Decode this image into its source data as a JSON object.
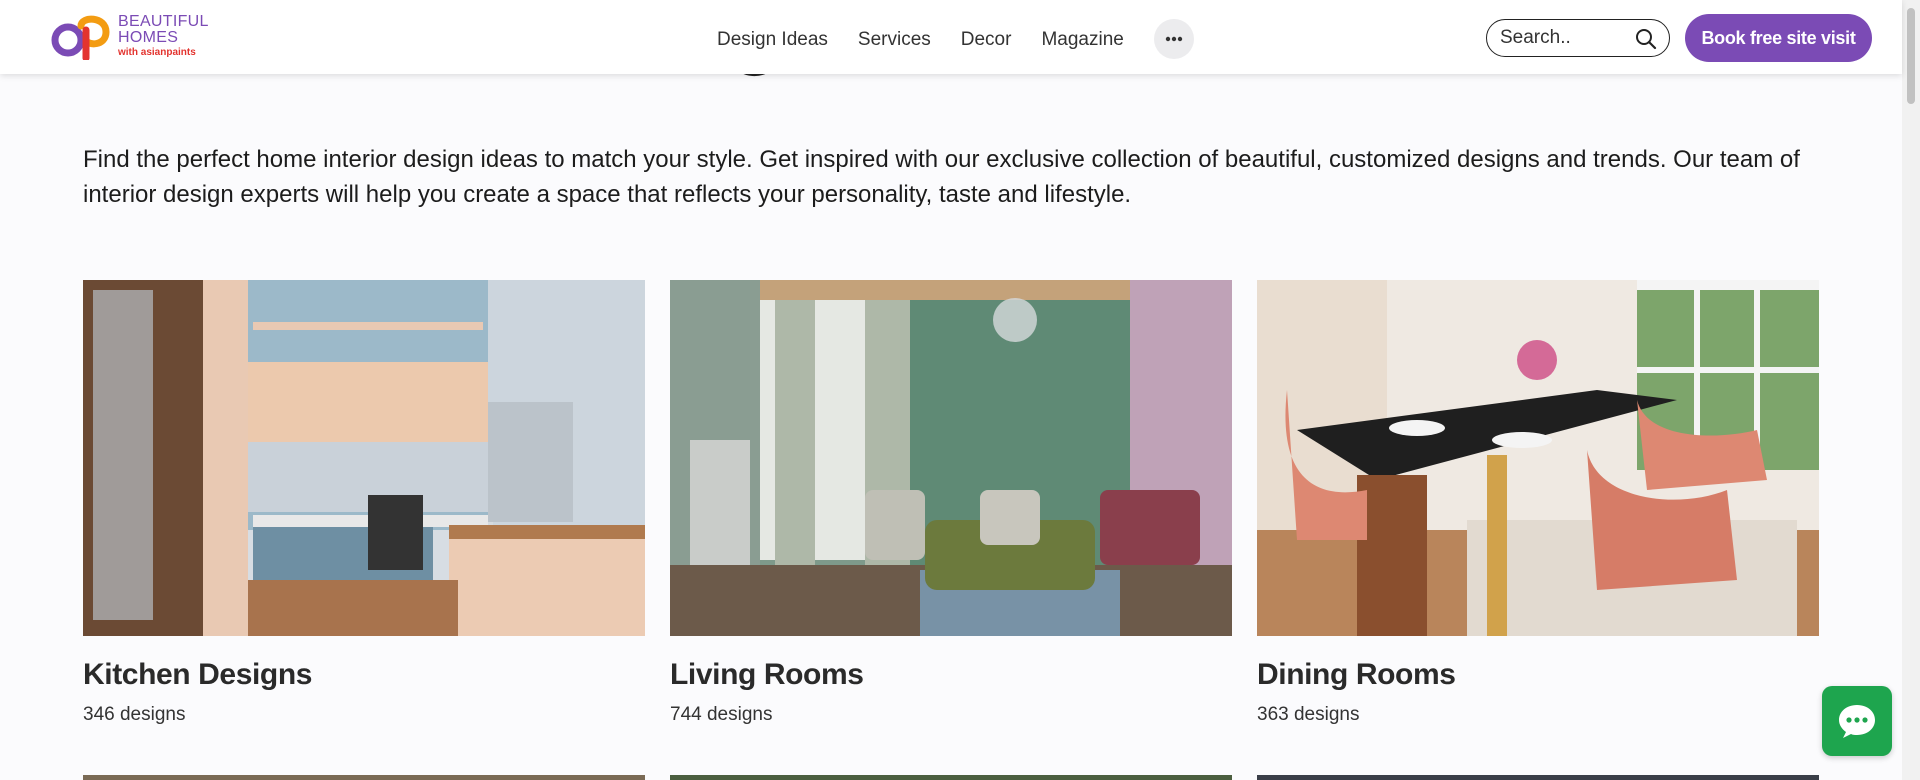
{
  "brand": {
    "line1": "BEAUTIFUL",
    "line2": "HOMES",
    "line3": "with asianpaints",
    "color": "#7b4bb5"
  },
  "nav": {
    "items": [
      {
        "label": "Design Ideas"
      },
      {
        "label": "Services"
      },
      {
        "label": "Decor"
      },
      {
        "label": "Magazine"
      }
    ],
    "more_icon": "ellipsis-icon"
  },
  "search": {
    "placeholder": "Search..",
    "icon": "search-icon"
  },
  "cta": {
    "label": "Book free site visit",
    "color": "#7b4bb5"
  },
  "intro": {
    "text": "Find the perfect home interior design ideas to match your style. Get inspired with our exclusive collection of beautiful, customized designs and trends. Our team of interior design experts will help you create a space that reflects your personality, taste and lifestyle."
  },
  "cards": [
    {
      "title": "Kitchen Designs",
      "count": "346 designs",
      "image": "kitchen-photo"
    },
    {
      "title": "Living Rooms",
      "count": "744 designs",
      "image": "living-room-photo"
    },
    {
      "title": "Dining Rooms",
      "count": "363 designs",
      "image": "dining-room-photo"
    }
  ],
  "chat": {
    "icon": "chat-bubble-icon",
    "color": "#1ea54e"
  }
}
